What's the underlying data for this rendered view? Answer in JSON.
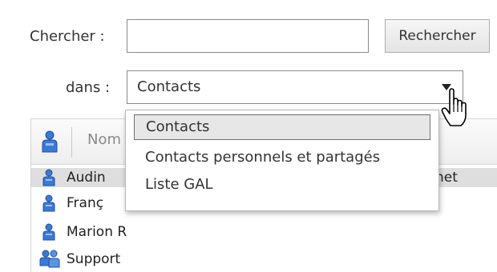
{
  "search": {
    "label": "Chercher :",
    "value": "",
    "button": "Rechercher"
  },
  "scope": {
    "label": "dans :",
    "selected": "Contacts",
    "options": [
      "Contacts",
      "Contacts personnels et partagés",
      "Liste GAL"
    ]
  },
  "list": {
    "column_name": "Nom",
    "rows": [
      {
        "name": "Audin",
        "extra": "net",
        "type": "person"
      },
      {
        "name": "Franç",
        "type": "person"
      },
      {
        "name": "Marion R",
        "type": "person"
      },
      {
        "name": "Support",
        "type": "group"
      }
    ]
  },
  "colors": {
    "accent": "#2f6fd4",
    "highlight": "#e7e7e7",
    "selected_row": "#dedede"
  }
}
